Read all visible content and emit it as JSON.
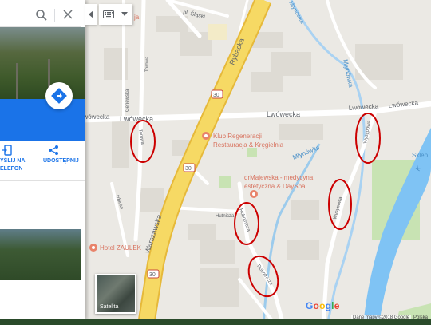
{
  "search": {
    "value": "",
    "placeholder": ""
  },
  "panel": {
    "directions_label": "Wyznacz trasę",
    "send_label_line1": "YŚLIJ NA",
    "send_label_line2": "ELEFON",
    "share_label": "UDOSTĘPNIJ"
  },
  "map": {
    "streets": {
      "rybacka": "Rybacka",
      "plslaski": "pl. Śląski",
      "torowa_top": "Torowa",
      "genewska": "Genewska",
      "lwowecka_left": "Lwówecka",
      "lwowecka_mid": "Lwówecka",
      "lwowecka_right": "Lwówecka",
      "lwowecka_far": "Lwówecka",
      "torowa_circled": "Torowa",
      "izbicka": "Izbicka",
      "warszawska": "Warszawska",
      "hutnicza": "Hutnicza",
      "robotnicza_1": "Robotnicza",
      "robotnicza_2": "Robotnicza",
      "wysypowa_1": "Wysypowa",
      "wysypowa_2": "Wysypowa",
      "mlynowka_top": "Młynówka",
      "mlynowka_mid": "Młynówka",
      "mlynowka_small": "Młynówka",
      "badge_30a": "30",
      "badge_30b": "30",
      "badge_30c": "30",
      "kwisa_partial": "K",
      "sklep_partial": "Sklep",
      "top_partial": "ja"
    },
    "pois": {
      "klub_line1": "Klub Regeneracji",
      "klub_line2": "Restauracja & Kręgielnia",
      "drmajewska_line1": "drMajewska - medycyna",
      "drmajewska_line2": "estetyczna & DaySpa",
      "hotel": "Hotel ZAULEK"
    }
  },
  "controls": {
    "satellite_label": "Satelita"
  },
  "google_logo": [
    "G",
    "o",
    "o",
    "g",
    "l",
    "e"
  ],
  "attribution": "Dane mapy ©2018 Google",
  "attribution_extra": "Polska",
  "colors": {
    "road_major": "#f6d964",
    "water": "#7fc3f4",
    "panel_blue": "#1a73e8",
    "annotation_red": "#cc0000"
  }
}
